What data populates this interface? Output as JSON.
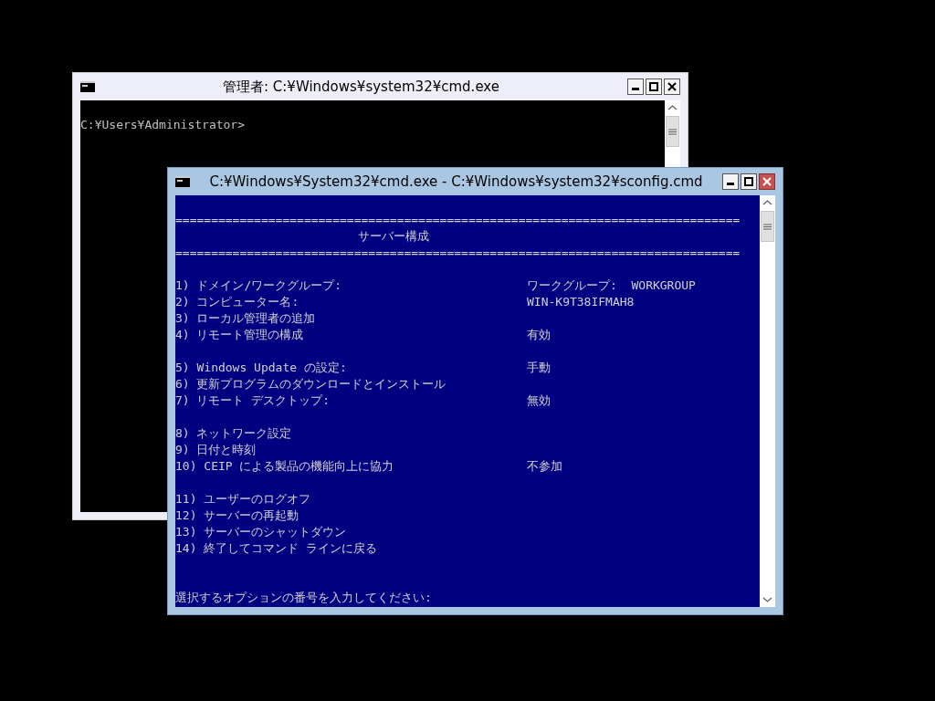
{
  "windows": [
    {
      "title": "管理者: C:¥Windows¥system32¥cmd.exe",
      "active": false,
      "kind": "plain",
      "lines": [
        {
          "kind": "blank"
        },
        {
          "kind": "text",
          "label": "C:¥Users¥Administrator>"
        }
      ]
    },
    {
      "title": "C:¥Windows¥System32¥cmd.exe - C:¥Windows¥system32¥sconfig.cmd",
      "active": true,
      "kind": "sconfig",
      "lines": [
        {
          "kind": "blank"
        },
        {
          "kind": "rule",
          "label": "==============================================================================="
        },
        {
          "kind": "heading",
          "label": "サーバー構成"
        },
        {
          "kind": "rule",
          "label": "==============================================================================="
        },
        {
          "kind": "blank"
        },
        {
          "kind": "item",
          "label": "1) ドメイン/ワークグループ:",
          "value": "ワークグループ:  WORKGROUP"
        },
        {
          "kind": "item",
          "label": "2) コンピューター名:",
          "value": "WIN-K9T38IFMAH8"
        },
        {
          "kind": "item",
          "label": "3) ローカル管理者の追加"
        },
        {
          "kind": "item",
          "label": "4) リモート管理の構成",
          "value": "有効"
        },
        {
          "kind": "blank"
        },
        {
          "kind": "item",
          "label": "5) Windows Update の設定:",
          "value": "手動"
        },
        {
          "kind": "item",
          "label": "6) 更新プログラムのダウンロードとインストール"
        },
        {
          "kind": "item",
          "label": "7) リモート デスクトップ:",
          "value": "無効"
        },
        {
          "kind": "blank"
        },
        {
          "kind": "item",
          "label": "8) ネットワーク設定"
        },
        {
          "kind": "item",
          "label": "9) 日付と時刻"
        },
        {
          "kind": "item",
          "label": "10) CEIP による製品の機能向上に協力",
          "value": "不参加"
        },
        {
          "kind": "blank"
        },
        {
          "kind": "item",
          "label": "11) ユーザーのログオフ"
        },
        {
          "kind": "item",
          "label": "12) サーバーの再起動"
        },
        {
          "kind": "item",
          "label": "13) サーバーのシャットダウン"
        },
        {
          "kind": "item",
          "label": "14) 終了してコマンド ラインに戻る"
        },
        {
          "kind": "blank"
        },
        {
          "kind": "blank"
        },
        {
          "kind": "text",
          "label": "選択するオプションの番号を入力してください:"
        }
      ]
    }
  ]
}
